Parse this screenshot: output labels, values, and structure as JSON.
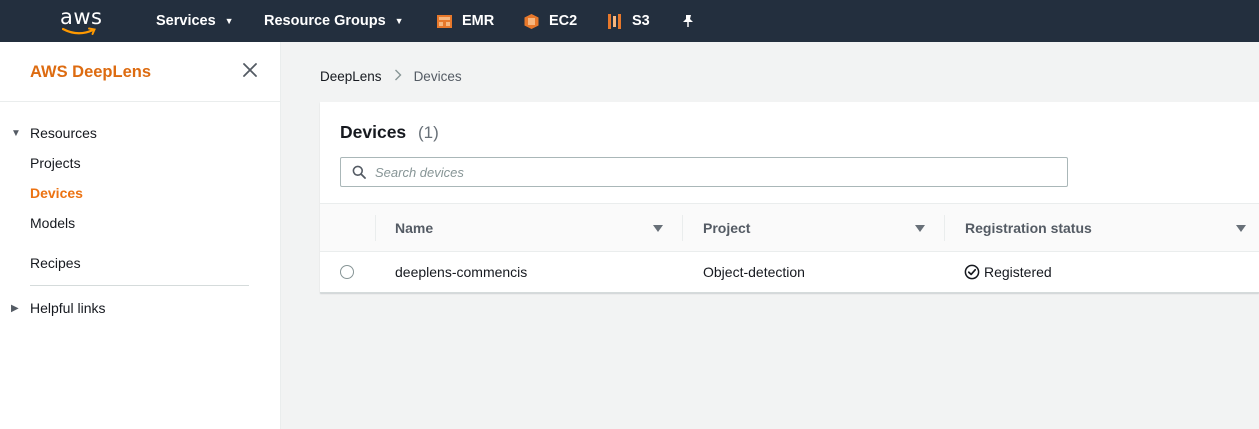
{
  "topnav": {
    "logo_text": "aws",
    "services_label": "Services",
    "resource_groups_label": "Resource Groups",
    "shortcuts": [
      {
        "label": "EMR",
        "icon": "emr-icon"
      },
      {
        "label": "EC2",
        "icon": "ec2-icon"
      },
      {
        "label": "S3",
        "icon": "s3-icon"
      }
    ],
    "pin_icon": "pin-icon",
    "colors": {
      "bar": "#232f3e",
      "service_icon": "#e7782b"
    }
  },
  "sidebar": {
    "title": "AWS DeepLens",
    "resources_label": "Resources",
    "items": [
      {
        "label": "Projects",
        "active": false
      },
      {
        "label": "Devices",
        "active": true
      },
      {
        "label": "Models",
        "active": false
      }
    ],
    "recipes_label": "Recipes",
    "helpful_links_label": "Helpful links",
    "colors": {
      "title": "#dd6b10",
      "active": "#ec7211"
    }
  },
  "breadcrumb": {
    "parent": "DeepLens",
    "current": "Devices"
  },
  "devices": {
    "title": "Devices",
    "count": "(1)",
    "search_placeholder": "Search devices",
    "columns": [
      "Name",
      "Project",
      "Registration status"
    ],
    "rows": [
      {
        "name": "deeplens-commencis",
        "project": "Object-detection",
        "status": "Registered"
      }
    ]
  }
}
